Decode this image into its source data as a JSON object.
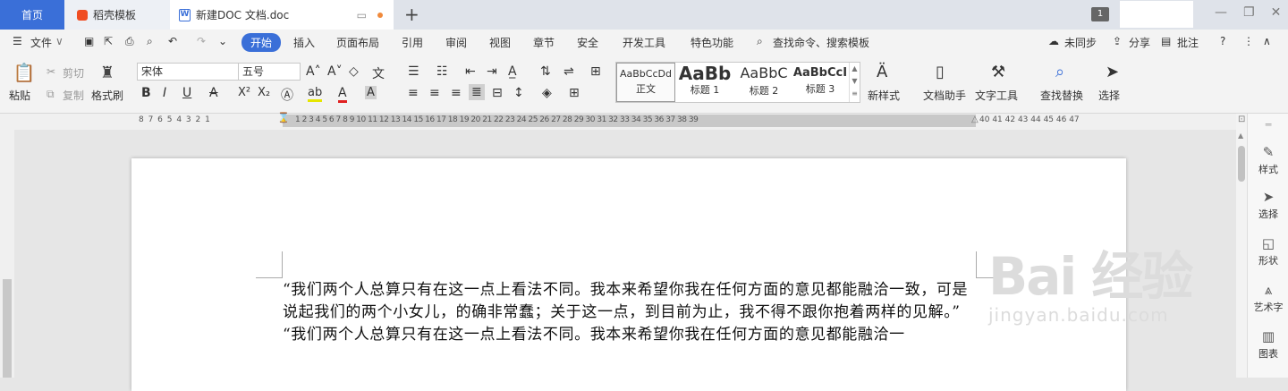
{
  "tabs": {
    "home": "首页",
    "daoke": "稻壳模板",
    "doc": "新建DOC 文档.doc",
    "badge": "1"
  },
  "menu": {
    "file": "文件",
    "items": [
      "开始",
      "插入",
      "页面布局",
      "引用",
      "审阅",
      "视图",
      "章节",
      "安全",
      "开发工具",
      "特色功能"
    ],
    "search": "查找命令、搜索模板",
    "sync": "未同步",
    "share": "分享",
    "comment": "批注"
  },
  "ribbon": {
    "paste": "粘贴",
    "cut": "剪切",
    "copy": "复制",
    "format_painter": "格式刷",
    "font_name": "宋体",
    "font_size": "五号",
    "styles": [
      {
        "preview": "AaBbCcDd",
        "name": "正文"
      },
      {
        "preview": "AaBb",
        "name": "标题 1"
      },
      {
        "preview": "AaBbC",
        "name": "标题 2"
      },
      {
        "preview": "AaBbCcI",
        "name": "标题 3"
      }
    ],
    "new_style": "新样式",
    "doc_helper": "文档助手",
    "text_tools": "文字工具",
    "find_replace": "查找替换",
    "select": "选择"
  },
  "ruler": {
    "left_ticks": "8   7   6   5   4   3   2   1",
    "main_ticks": "1   2   3   4   5   6   7   8   9  10  11  12  13  14  15  16  17  18  19  20  21  22  23  24  25  26  27  28  29  30  31  32  33  34  35  36  37  38  39",
    "right_ticks": "40  41  42  43  44  45  46  47"
  },
  "document": {
    "para1": "“我们两个人总算只有在这一点上看法不同。我本来希望你我在任何方面的意见都能融洽一致，可是说起我们的两个小女儿，的确非常蠢；关于这一点，到目前为止，我不得不跟你抱着两样的见解。”",
    "para2": "“我们两个人总算只有在这一点上看法不同。我本来希望你我在任何方面的意见都能融洽一"
  },
  "right_panel": {
    "style": "样式",
    "select": "选择",
    "shape": "形状",
    "art": "艺术字",
    "chart": "图表"
  },
  "watermark": {
    "main": "Bai 经验",
    "sub": "jingyan.baidu.com"
  },
  "colors": {
    "accent": "#3a6fd8",
    "tab_dot": "#f08a3c",
    "daoke": "#f04d22"
  }
}
